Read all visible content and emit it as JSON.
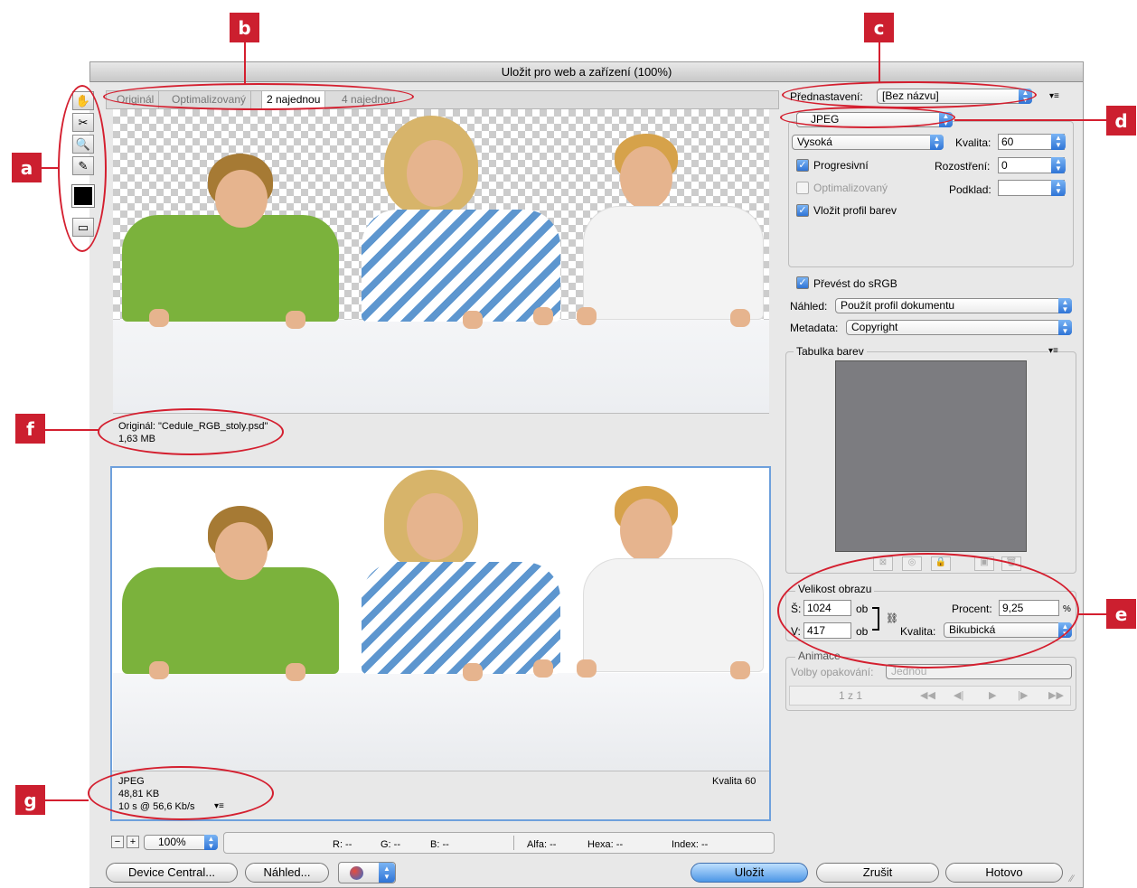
{
  "window": {
    "title": "Uložit pro web a zařízení (100%)"
  },
  "callouts": [
    "a",
    "b",
    "c",
    "d",
    "e",
    "f",
    "g"
  ],
  "tabs": [
    {
      "label": "Originál"
    },
    {
      "label": "Optimalizovaný"
    },
    {
      "label": "2 najednou"
    },
    {
      "label": "4 najednou"
    }
  ],
  "tools": [
    "hand-icon",
    "slice-select-icon",
    "zoom-icon",
    "eyedropper-icon",
    "color-swatch",
    "toggle-slices-icon"
  ],
  "original_info": {
    "line1": "Originál: \"Cedule_RGB_stoly.psd\"",
    "line2": "1,63 MB"
  },
  "optimized_info": {
    "line1": "JPEG",
    "line2": "48,81 KB",
    "line3": "10 s @ 56,6 Kb/s",
    "quality": "Kvalita 60"
  },
  "right": {
    "preset_label": "Přednastavení:",
    "preset_value": "[Bez názvu]",
    "format": "JPEG",
    "quality_preset": "Vysoká",
    "quality_label": "Kvalita:",
    "quality_value": "60",
    "progressive_label": "Progresivní",
    "blur_label": "Rozostření:",
    "blur_value": "0",
    "optimized_label": "Optimalizovaný",
    "matte_label": "Podklad:",
    "embed_label": "Vložit profil barev",
    "srgb_label": "Převést do sRGB",
    "preview_label": "Náhled:",
    "preview_value": "Použít profil dokumentu",
    "metadata_label": "Metadata:",
    "metadata_value": "Copyright",
    "color_table_title": "Tabulka barev",
    "image_size_title": "Velikost obrazu",
    "w_label": "Š:",
    "w_value": "1024",
    "h_label": "V:",
    "h_value": "417",
    "unit": "ob",
    "percent_label": "Procent:",
    "percent_value": "9,25",
    "percent_unit": "%",
    "resample_label": "Kvalita:",
    "resample_value": "Bikubická",
    "animation_title": "Animace",
    "loop_label": "Volby opakování:",
    "loop_value": "Jednou",
    "frame_counter": "1 z 1"
  },
  "status": {
    "zoom": "100%",
    "r": "R: --",
    "g": "G: --",
    "b": "B: --",
    "alpha": "Alfa: --",
    "hex": "Hexa: --",
    "index": "Index: --"
  },
  "buttons": {
    "device_central": "Device Central...",
    "preview": "Náhled...",
    "save": "Uložit",
    "cancel": "Zrušit",
    "done": "Hotovo"
  },
  "colors": {
    "accent": "#3a7fd6",
    "callout": "#cc1f2f",
    "shirt_green": "#7bb23c",
    "shirt_blue": "#5d96cf"
  }
}
